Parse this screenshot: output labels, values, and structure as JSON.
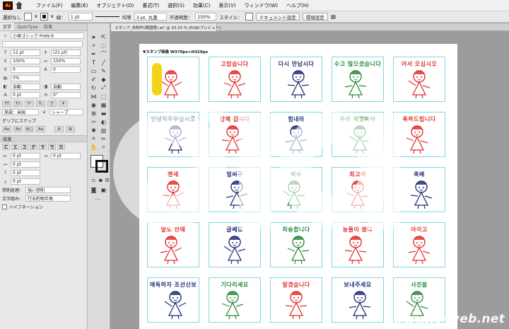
{
  "menubar": {
    "logo": "Ai",
    "items": [
      "ファイル(F)",
      "編集(E)",
      "オブジェクト(O)",
      "書式(T)",
      "選択(S)",
      "効果(C)",
      "表示(V)",
      "ウィンドウ(W)",
      "ヘルプ(H)"
    ]
  },
  "control": {
    "selection": "選択なし",
    "stroke_label": "線：",
    "stroke_weight": "1 pt",
    "brush_style": "均等",
    "brush_size": "3 pt. 丸筆",
    "opacity_label": "不透明度：",
    "opacity": "100%",
    "style_label": "スタイル：",
    "doc_settings": "ドキュメント設定",
    "prefs": "環境設定"
  },
  "char_panel": {
    "tabs": [
      "文字",
      "OpenType",
      "段落"
    ],
    "font_family": "小塚ゴシック Pr6N R",
    "font_style": "-",
    "font_size": "12 pt",
    "leading": "(21 pt)",
    "vscale": "100%",
    "hscale": "100%",
    "kerning": "0",
    "tracking": "0",
    "tsume": "0%",
    "aki_left": "自動",
    "aki_right": "自動",
    "baseline": "0 pt",
    "rotation": "0°",
    "lang": "英語：米国",
    "aa": "シャープ",
    "snap_label": "グリフにスナップ"
  },
  "para_panel": {
    "title": "段落",
    "indent_left": "0 pt",
    "indent_right": "0 pt",
    "first_line": "0 pt",
    "space_before": "0 pt",
    "space_after": "0 pt",
    "kinsoku_label": "禁則処理：",
    "kinsoku": "強い禁則",
    "mojikumi_label": "文字組み：",
    "mojikumi": "行末約物半角",
    "hyphen_label": "ハイフネーション"
  },
  "document": {
    "tab_title": "スタンプ_本制作(韓国語).ai* @ 33.33 % (RGB/プレビュー)",
    "artboard_label": "▼スタンプ画像  W370px×H320px"
  },
  "stamps": [
    {
      "text": "",
      "color": "#e0322f",
      "figure": "girl-sign"
    },
    {
      "text": "고맙습니다",
      "color": "#e0322f",
      "figure": "girl-bow"
    },
    {
      "text": "다시 만납시다",
      "color": "#23307a",
      "figure": "boy-wave"
    },
    {
      "text": "수고 많으셨습니다",
      "color": "#2a8a3c",
      "figure": "woman-fan"
    },
    {
      "text": "어서 오십시오",
      "color": "#e0322f",
      "figure": "girl-dance"
    },
    {
      "text": "안녕히주무십시오",
      "color": "#23307a",
      "figure": "sleep"
    },
    {
      "text": "함께 갑시다",
      "color": "#e0322f",
      "figure": "two-kids"
    },
    {
      "text": "힘내라",
      "color": "#23307a",
      "figure": "cheer"
    },
    {
      "text": "우리 제일이야",
      "color": "#2a8a3c",
      "figure": "team"
    },
    {
      "text": "축하드립니다",
      "color": "#e0322f",
      "figure": "celebrate"
    },
    {
      "text": "맨세",
      "color": "#e0322f",
      "figure": "girl-run"
    },
    {
      "text": "얼씨구",
      "color": "#23307a",
      "figure": "dance-pair"
    },
    {
      "text": "박수",
      "color": "#2a8a3c",
      "figure": "clap"
    },
    {
      "text": "최고예",
      "color": "#e0322f",
      "figure": "thumb"
    },
    {
      "text": "축배",
      "color": "#23307a",
      "figure": "toast"
    },
    {
      "text": "말도 안돼",
      "color": "#e0322f",
      "figure": "shock"
    },
    {
      "text": "글쎄요",
      "color": "#23307a",
      "figure": "think"
    },
    {
      "text": "죄송합니다",
      "color": "#2a8a3c",
      "figure": "sorry"
    },
    {
      "text": "농들이 왔다",
      "color": "#e0322f",
      "figure": "surprise"
    },
    {
      "text": "아이고",
      "color": "#e0322f",
      "figure": "ouch"
    },
    {
      "text": "애독하자 조선신보",
      "color": "#23307a",
      "figure": "newspaper"
    },
    {
      "text": "기다리세요",
      "color": "#2a8a3c",
      "figure": "wait"
    },
    {
      "text": "알겠습니다",
      "color": "#e0322f",
      "figure": "ok"
    },
    {
      "text": "보내주세요",
      "color": "#23307a",
      "figure": "send"
    },
    {
      "text": "사진을",
      "color": "#2a8a3c",
      "figure": "photo"
    }
  ],
  "watermark": {
    "url": "www.io-web.net"
  }
}
